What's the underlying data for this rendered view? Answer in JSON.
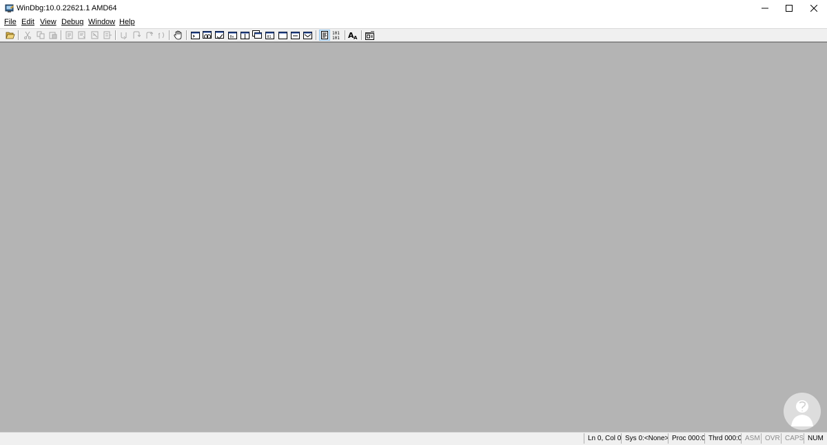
{
  "window": {
    "title": "WinDbg:10.0.22621.1 AMD64",
    "controls": [
      "minimize",
      "maximize",
      "close"
    ]
  },
  "menu": {
    "items": [
      {
        "label": "File"
      },
      {
        "label": "Edit"
      },
      {
        "label": "View"
      },
      {
        "label": "Debug"
      },
      {
        "label": "Window"
      },
      {
        "label": "Help"
      }
    ]
  },
  "toolbar": {
    "buttons": [
      {
        "icon": "open-folder-icon",
        "enabled": true
      },
      {
        "icon": "cut-icon",
        "enabled": false
      },
      {
        "icon": "copy-icon",
        "enabled": false
      },
      {
        "icon": "paste-icon",
        "enabled": false
      },
      {
        "icon": "go-icon",
        "enabled": false
      },
      {
        "icon": "restart-icon",
        "enabled": false
      },
      {
        "icon": "stop-debugging-icon",
        "enabled": false
      },
      {
        "icon": "detach-icon",
        "enabled": false
      },
      {
        "icon": "step-into-icon",
        "enabled": false
      },
      {
        "icon": "step-over-icon",
        "enabled": false
      },
      {
        "icon": "step-out-icon",
        "enabled": false
      },
      {
        "icon": "run-to-cursor-icon",
        "enabled": false
      },
      {
        "icon": "break-hand-icon",
        "enabled": true
      },
      {
        "icon": "command-window-icon",
        "enabled": true
      },
      {
        "icon": "watch-window-icon",
        "enabled": true
      },
      {
        "icon": "locals-window-icon",
        "enabled": true
      },
      {
        "icon": "registers-window-icon",
        "enabled": true
      },
      {
        "icon": "memory-window-icon",
        "enabled": true
      },
      {
        "icon": "call-stack-window-icon",
        "enabled": true
      },
      {
        "icon": "disassembly-window-icon",
        "enabled": true
      },
      {
        "icon": "scratch-pad-window-icon",
        "enabled": true
      },
      {
        "icon": "processes-threads-window-icon",
        "enabled": true
      },
      {
        "icon": "source-mode-icon",
        "enabled": true,
        "active": true
      },
      {
        "icon": "hex-mode-icon",
        "enabled": true
      },
      {
        "icon": "font-icon",
        "enabled": true
      },
      {
        "icon": "options-icon",
        "enabled": true
      }
    ]
  },
  "statusbar": {
    "line_col": "Ln 0, Col 0",
    "sys": "Sys 0:<None>",
    "proc": "Proc 000:0",
    "thrd": "Thrd 000:0",
    "asm": "ASM",
    "ovr": "OVR",
    "caps": "CAPS",
    "num": "NUM"
  }
}
